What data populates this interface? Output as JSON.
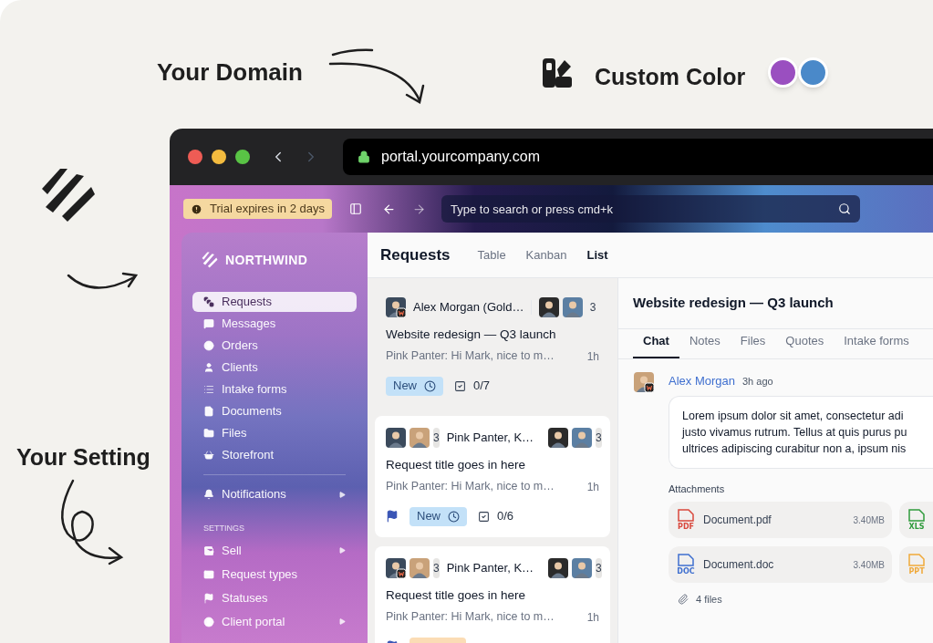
{
  "annotations": [
    {
      "kind": "domain",
      "label": "Your Domain"
    },
    {
      "kind": "color",
      "label": "Custom Color"
    },
    {
      "kind": "setting",
      "label": "Your Setting"
    }
  ],
  "swatches": [
    {
      "color": "#9a4fc0"
    },
    {
      "color": "#4a89c9"
    }
  ],
  "browser": {
    "url": "portal.yourcompany.com"
  },
  "topbar": {
    "trial": "Trial expires in 2 days",
    "search": {
      "placeholder": "Type to search or press cmd+k"
    }
  },
  "sidebar": {
    "brand": "NORTHWIND",
    "items": [
      {
        "label": "Requests",
        "selected": true,
        "submenu": false
      },
      {
        "label": "Messages",
        "selected": false,
        "submenu": false
      },
      {
        "label": "Orders",
        "selected": false,
        "submenu": false
      },
      {
        "label": "Clients",
        "selected": false,
        "submenu": false
      },
      {
        "label": "Intake forms",
        "selected": false,
        "submenu": false
      },
      {
        "label": "Documents",
        "selected": false,
        "submenu": false
      },
      {
        "label": "Files",
        "selected": false,
        "submenu": false
      },
      {
        "label": "Storefront",
        "selected": false,
        "submenu": false
      }
    ],
    "extra": [
      {
        "label": "Notifications",
        "selected": false,
        "submenu": true
      }
    ],
    "section": "SETTINGS",
    "settings": [
      {
        "label": "Sell",
        "selected": false,
        "submenu": true
      },
      {
        "label": "Request types",
        "selected": false,
        "submenu": false
      },
      {
        "label": "Statuses",
        "selected": false,
        "submenu": false
      },
      {
        "label": "Client portal",
        "selected": false,
        "submenu": true
      }
    ]
  },
  "requests": {
    "title": "Requests",
    "views": [
      {
        "label": "Table",
        "selected": false
      },
      {
        "label": "Kanban",
        "selected": false
      },
      {
        "label": "List",
        "selected": true
      }
    ],
    "cards": [
      {
        "selected": true,
        "from": {
          "avatars": [
            {
              "badge": true
            }
          ],
          "name": "Alex Morgan (Gold…"
        },
        "team": {
          "avatars": [
            {
              "badge": false
            },
            {
              "badge": false
            }
          ],
          "count": "3"
        },
        "title": "Website redesign — Q3 launch",
        "preview": "Pink Panter: Hi Mark, nice to m…",
        "time": "1h",
        "flagged": false,
        "status": {
          "label": "New",
          "color": "#c3e1f8"
        },
        "tasks": "0/7"
      },
      {
        "selected": false,
        "from": {
          "avatars": [
            {
              "badge": false
            },
            {
              "badge": false
            }
          ],
          "count": "3",
          "name": "Pink Panter, K…"
        },
        "team": {
          "avatars": [
            {
              "badge": false
            },
            {
              "badge": false
            }
          ],
          "count": "3"
        },
        "title": "Request title goes in here",
        "preview": "Pink Panter: Hi Mark, nice to m…",
        "time": "1h",
        "flagged": true,
        "status": {
          "label": "New",
          "color": "#c3e1f8"
        },
        "tasks": "0/6"
      },
      {
        "selected": false,
        "from": {
          "avatars": [
            {
              "badge": true
            },
            {
              "badge": false
            }
          ],
          "count": "3",
          "name": "Pink Panter, K…"
        },
        "team": {
          "avatars": [
            {
              "badge": false
            },
            {
              "badge": false
            }
          ],
          "count": "3"
        },
        "title": "Request title goes in here",
        "preview": "Pink Panter: Hi Mark, nice to m…",
        "time": "1h",
        "flagged": true,
        "status": {
          "color": "#fbdcb5"
        }
      }
    ]
  },
  "detail": {
    "title": "Website redesign — Q3 launch",
    "tabs": [
      {
        "label": "Chat",
        "selected": true
      },
      {
        "label": "Notes",
        "selected": false
      },
      {
        "label": "Files",
        "selected": false
      },
      {
        "label": "Quotes",
        "selected": false
      },
      {
        "label": "Intake forms",
        "selected": false
      }
    ],
    "message": {
      "author": "Alex Morgan",
      "time": "3h ago",
      "lines": [
        "Lorem ipsum dolor sit amet, consectetur adi",
        "justo vivamus rutrum. Tellus at quis purus pu",
        "ultrices adipiscing curabitur non a, ipsum nis"
      ]
    },
    "attachments_label": "Attachments",
    "attachments": [
      {
        "badge": "PDF",
        "color": "#d9473c",
        "name": "Document.pdf",
        "size": "3.40MB"
      },
      {
        "badge": "XLS",
        "color": "#2f9a3c"
      },
      {
        "badge": "DOC",
        "color": "#3f6fcf",
        "name": "Document.doc",
        "size": "3.40MB"
      },
      {
        "badge": "PPT",
        "color": "#f0a93a"
      }
    ],
    "file_count": "4 files"
  }
}
